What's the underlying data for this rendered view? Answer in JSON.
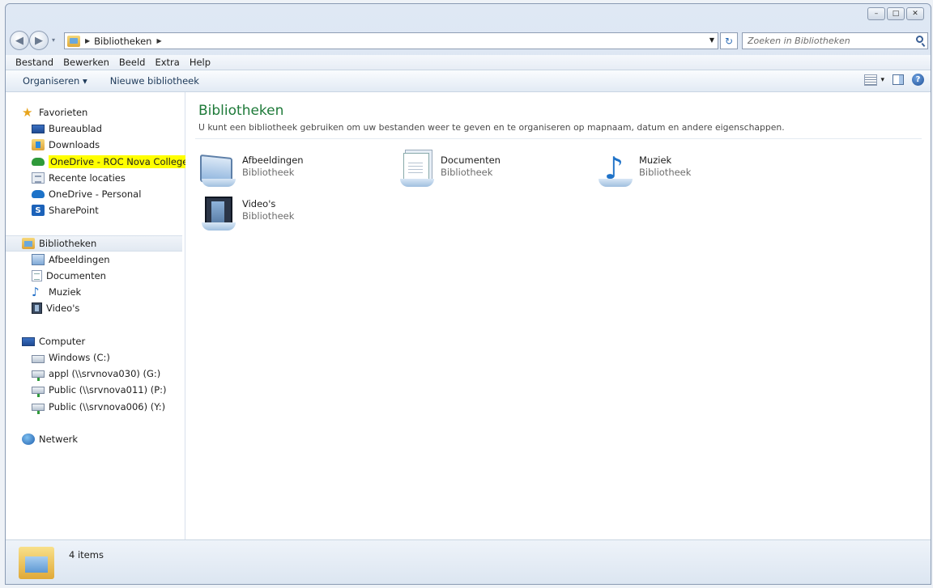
{
  "window": {
    "minimize_glyph": "–",
    "maximize_glyph": "□",
    "close_glyph": "✕"
  },
  "address": {
    "back_glyph": "◀",
    "forward_glyph": "▶",
    "location": "Bibliotheken",
    "refresh_glyph": "↻",
    "search_placeholder": "Zoeken in Bibliotheken"
  },
  "menubar": [
    "Bestand",
    "Bewerken",
    "Beeld",
    "Extra",
    "Help"
  ],
  "commandbar": {
    "organize": "Organiseren ▾",
    "new_library": "Nieuwe bibliotheek",
    "view_menu_glyph": "▾",
    "help_glyph": "?"
  },
  "nav": {
    "favorites": {
      "label": "Favorieten",
      "items": [
        "Bureaublad",
        "Downloads",
        "OneDrive - ROC Nova College",
        "Recente locaties",
        "OneDrive - Personal",
        "SharePoint"
      ]
    },
    "libraries": {
      "label": "Bibliotheken",
      "items": [
        "Afbeeldingen",
        "Documenten",
        "Muziek",
        "Video's"
      ]
    },
    "computer": {
      "label": "Computer",
      "items": [
        "Windows (C:)",
        "appl (\\\\srvnova030) (G:)",
        "Public (\\\\srvnova011) (P:)",
        "Public (\\\\srvnova006) (Y:)"
      ]
    },
    "network": {
      "label": "Netwerk"
    }
  },
  "content": {
    "title": "Bibliotheken",
    "description": "U kunt een bibliotheek gebruiken om uw bestanden weer te geven en te organiseren op mapnaam, datum en andere eigenschappen.",
    "libraries": [
      {
        "name": "Afbeeldingen",
        "type": "Bibliotheek",
        "icon": "pictures-library-icon"
      },
      {
        "name": "Documenten",
        "type": "Bibliotheek",
        "icon": "documents-library-icon"
      },
      {
        "name": "Muziek",
        "type": "Bibliotheek",
        "icon": "music-library-icon"
      },
      {
        "name": "Video's",
        "type": "Bibliotheek",
        "icon": "videos-library-icon"
      }
    ]
  },
  "details": {
    "count": "4 items"
  },
  "colors": {
    "title_green": "#1e7a39",
    "highlight_yellow": "#ffff00",
    "chrome_blue": "#dfe8f4"
  }
}
